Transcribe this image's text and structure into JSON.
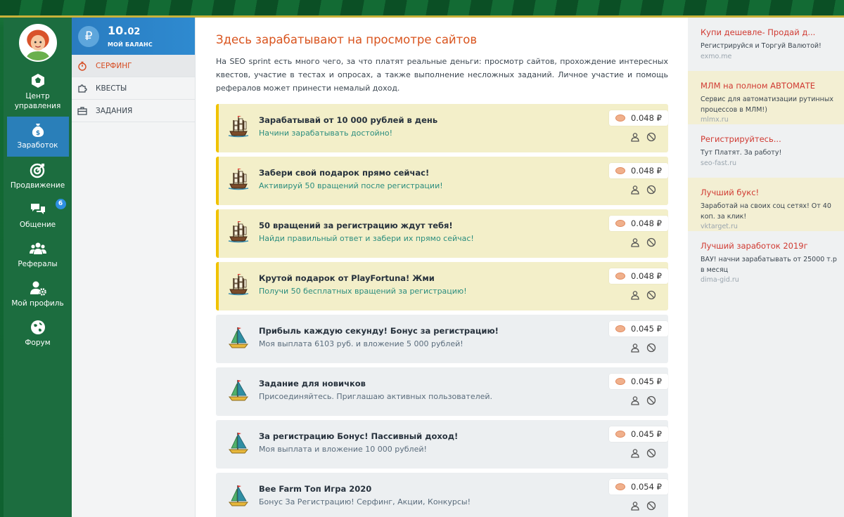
{
  "sidebar": {
    "items": [
      {
        "label": "Центр управления",
        "icon": "dice-icon"
      },
      {
        "label": "Заработок",
        "icon": "money-bag-icon"
      },
      {
        "label": "Продвижение",
        "icon": "target-icon"
      },
      {
        "label": "Общение",
        "icon": "chat-icon",
        "badge": "6"
      },
      {
        "label": "Рефералы",
        "icon": "users-icon"
      },
      {
        "label": "Мой профиль",
        "icon": "user-gear-icon"
      },
      {
        "label": "Форум",
        "icon": "globe-icon"
      }
    ]
  },
  "balance": {
    "currency_symbol": "₽",
    "amount_int": "10.",
    "amount_frac": "02",
    "label": "МОЙ БАЛАНС"
  },
  "subnav": {
    "items": [
      {
        "label": "СЕРФИНГ",
        "icon": "stopwatch-icon"
      },
      {
        "label": "КВЕСТЫ",
        "icon": "puzzle-icon"
      },
      {
        "label": "ЗАДАНИЯ",
        "icon": "briefcase-icon"
      }
    ]
  },
  "main": {
    "title": "Здесь зарабатывают на просмотре сайтов",
    "intro": "На SEO sprint есть много чего, за что платят реальные деньги: просмотр сайтов, прохождение интересных квестов, участие в тестах и опросах, а также выполнение несложных заданий. Личное участие и помощь рефералов может принести немалый доход.",
    "tasks": [
      {
        "title": "Зарабатывай от 10 000 рублей в день",
        "subtitle": "Начини зарабатывать достойно!",
        "price": "0.048 ₽",
        "kind": "promo"
      },
      {
        "title": "Забери свой подарок прямо сейчас!",
        "subtitle": "Активируй 50 вращений после регистрации!",
        "price": "0.048 ₽",
        "kind": "promo"
      },
      {
        "title": "50 вращений за регистрацию ждут тебя!",
        "subtitle": "Найди правильный ответ и забери их прямо сейчас!",
        "price": "0.048 ₽",
        "kind": "promo"
      },
      {
        "title": "Крутой подарок от PlayFortuna! Жми",
        "subtitle": "Получи 50 бесплатных вращений за регистрацию!",
        "price": "0.048 ₽",
        "kind": "promo"
      },
      {
        "title": "Прибыль каждую секунду! Бонус за регистрацию!",
        "subtitle": "Моя выплата 6103 руб. и вложение 5 000 рублей!",
        "price": "0.045 ₽",
        "kind": "normal"
      },
      {
        "title": "Задание для новичков",
        "subtitle": "Присоединяйтесь. Приглашаю активных пользователей.",
        "price": "0.045 ₽",
        "kind": "normal"
      },
      {
        "title": "За регистрацию Бонус! Пассивный доход!",
        "subtitle": "Моя выплата и вложение 10 000 рублей!",
        "price": "0.045 ₽",
        "kind": "normal"
      },
      {
        "title": "Bee Farm Топ Игра 2020",
        "subtitle": "Бонус За Регистрацию! Серфинг, Акции, Конкурсы!",
        "price": "0.054 ₽",
        "kind": "normal"
      }
    ]
  },
  "ads": [
    {
      "title": "Купи дешевле- Продай д...",
      "text": "Регистрируйся и Торгуй Валютой!",
      "url": "exmo.me",
      "highlight": false
    },
    {
      "title": "МЛМ на полном АВТОМАТЕ",
      "text": "Сервис для автоматизации рутинных процессов в МЛМ!)",
      "url": "mlmx.ru",
      "highlight": true
    },
    {
      "title": "Регистрируйтесь...",
      "text": "Тут Платят. За работу!",
      "url": "seo-fast.ru",
      "highlight": false
    },
    {
      "title": "Лучший букс!",
      "text": "Заработай на своих соц сетях! От 40 коп. за клик!",
      "url": "vktarget.ru",
      "highlight": true
    },
    {
      "title": "Лучший заработок 2019г",
      "text": "ВАУ! начни зарабатывать от 25000 т.р в месяц",
      "url": "dima-gid.ru",
      "highlight": false
    }
  ],
  "colors": {
    "accent": "#2a7fb9",
    "title_orange": "#d9541e",
    "ad_red": "#d03a32",
    "promo_bg": "#f3efc9",
    "promo_border": "#f0c200"
  }
}
